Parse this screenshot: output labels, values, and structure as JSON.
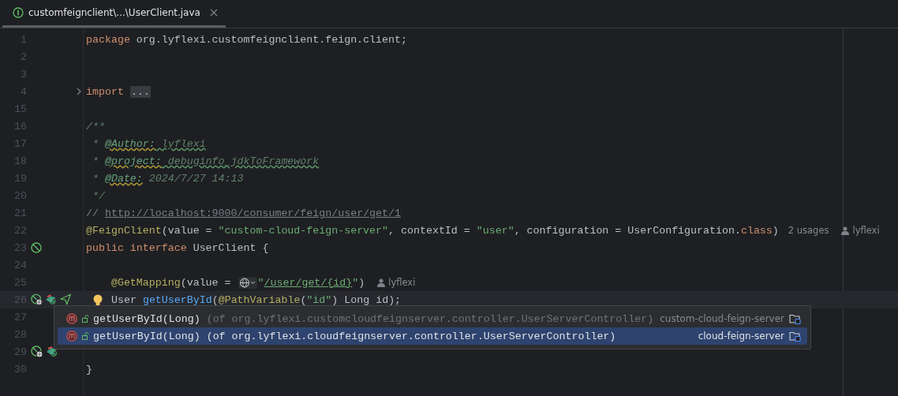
{
  "tab": {
    "title": "customfeignclient\\...\\UserClient.java",
    "selected": true
  },
  "lines": [
    {
      "number": "1",
      "current": false,
      "parts": [
        {
          "kind": "code",
          "tokens": [
            {
              "kind": "keyword",
              "text": "package"
            },
            {
              "kind": "plain",
              "text": " org.lyflexi.customfeignclient.feign.client;"
            }
          ]
        }
      ]
    },
    {
      "number": "2",
      "current": false
    },
    {
      "number": "3",
      "current": false
    },
    {
      "number": "4",
      "current": false,
      "gutter": [
        {
          "kind": "fold"
        }
      ],
      "parts": [
        {
          "kind": "code",
          "tokens": [
            {
              "kind": "keyword",
              "text": "import"
            }
          ]
        },
        {
          "kind": "folded",
          "text": "..."
        }
      ]
    },
    {
      "number": "15",
      "current": false
    },
    {
      "number": "16",
      "current": false,
      "parts": [
        {
          "kind": "code",
          "tokens": [
            {
              "kind": "doc",
              "text": "/**"
            }
          ]
        }
      ]
    },
    {
      "number": "17",
      "current": false,
      "parts": [
        {
          "kind": "code",
          "tokens": [
            {
              "kind": "doc",
              "text": " * "
            },
            {
              "kind": "doctag",
              "text": "@Author:"
            },
            {
              "kind": "docvalue",
              "text": " lyflexi"
            }
          ]
        }
      ]
    },
    {
      "number": "18",
      "current": false,
      "parts": [
        {
          "kind": "code",
          "tokens": [
            {
              "kind": "doc",
              "text": " * "
            },
            {
              "kind": "doctag",
              "text": "@project:"
            },
            {
              "kind": "docvalue",
              "text": " debuginfo_jdkToFramework"
            }
          ]
        }
      ]
    },
    {
      "number": "19",
      "current": false,
      "parts": [
        {
          "kind": "code",
          "tokens": [
            {
              "kind": "doc",
              "text": " * "
            },
            {
              "kind": "doctag",
              "text": "@Date:"
            },
            {
              "kind": "doc",
              "text": " 2024/7/27 14:13"
            }
          ]
        }
      ]
    },
    {
      "number": "20",
      "current": false,
      "parts": [
        {
          "kind": "code",
          "tokens": [
            {
              "kind": "doc",
              "text": " */"
            }
          ]
        }
      ]
    },
    {
      "number": "21",
      "current": false,
      "parts": [
        {
          "kind": "code",
          "tokens": [
            {
              "kind": "comment",
              "text": "//"
            }
          ]
        },
        {
          "kind": "link",
          "text": "http://localhost:9000/consumer/feign/user/get/1"
        }
      ]
    },
    {
      "number": "22",
      "current": false,
      "parts": [
        {
          "kind": "code",
          "tokens": [
            {
              "kind": "annotation",
              "text": "@FeignClient"
            },
            {
              "kind": "plain",
              "text": "(value = "
            },
            {
              "kind": "string",
              "text": "\"custom-cloud-feign-server\""
            },
            {
              "kind": "plain",
              "text": ", contextId = "
            },
            {
              "kind": "string",
              "text": "\"user\""
            },
            {
              "kind": "plain",
              "text": ", configuration = UserConfiguration."
            },
            {
              "kind": "keyword",
              "text": "class"
            },
            {
              "kind": "plain",
              "text": ")"
            }
          ]
        },
        {
          "kind": "hint",
          "text": "2 usages"
        },
        {
          "kind": "author",
          "text": "lyflexi"
        }
      ]
    },
    {
      "number": "23",
      "current": false,
      "gutter": [
        {
          "kind": "implemented"
        }
      ],
      "parts": [
        {
          "kind": "code",
          "tokens": [
            {
              "kind": "keyword",
              "text": "public interface"
            },
            {
              "kind": "plain",
              "text": " UserClient {"
            }
          ]
        }
      ]
    },
    {
      "number": "24",
      "current": false
    },
    {
      "number": "25",
      "current": false,
      "parts": [
        {
          "kind": "code",
          "tokens": [
            {
              "kind": "annotation",
              "text": "    @GetMapping"
            },
            {
              "kind": "plain",
              "text": "(value ="
            }
          ]
        },
        {
          "kind": "globe"
        },
        {
          "kind": "code",
          "tokens": [
            {
              "kind": "string",
              "text": "\""
            },
            {
              "kind": "stringlink",
              "text": "/user/get/{id}"
            },
            {
              "kind": "string",
              "text": "\""
            },
            {
              "kind": "plain",
              "text": ")"
            }
          ]
        },
        {
          "kind": "author",
          "text": "lyflexi"
        }
      ]
    },
    {
      "number": "26",
      "current": true,
      "gutter": [
        {
          "kind": "implemented-web"
        },
        {
          "kind": "bird"
        },
        {
          "kind": "send"
        }
      ],
      "parts": [
        {
          "kind": "bulb"
        },
        {
          "kind": "code",
          "tokens": [
            {
              "kind": "plain",
              "text": "User "
            },
            {
              "kind": "method",
              "text": "getUserById"
            },
            {
              "kind": "plain",
              "text": "("
            },
            {
              "kind": "annotation",
              "text": "@PathVariable"
            },
            {
              "kind": "plain",
              "text": "("
            },
            {
              "kind": "string",
              "text": "\"id\""
            },
            {
              "kind": "plain",
              "text": ") Long id);"
            }
          ]
        }
      ]
    },
    {
      "number": "27",
      "current": false
    },
    {
      "number": "28",
      "current": false
    },
    {
      "number": "29",
      "current": false,
      "gutter": [
        {
          "kind": "implemented-web"
        },
        {
          "kind": "bird"
        }
      ]
    },
    {
      "number": "30",
      "current": false,
      "parts": [
        {
          "kind": "code",
          "tokens": [
            {
              "kind": "plain",
              "text": "}"
            }
          ]
        }
      ]
    }
  ],
  "popup": {
    "items": [
      {
        "method": "getUserById(Long)",
        "location": "(of org.lyflexi.customcloudfeignserver.controller.UserServerController)",
        "module": "custom-cloud-feign-server",
        "selected": false
      },
      {
        "method": "getUserById(Long)",
        "location": "(of org.lyflexi.cloudfeignserver.controller.UserServerController)",
        "module": "cloud-feign-server",
        "selected": true
      }
    ]
  }
}
